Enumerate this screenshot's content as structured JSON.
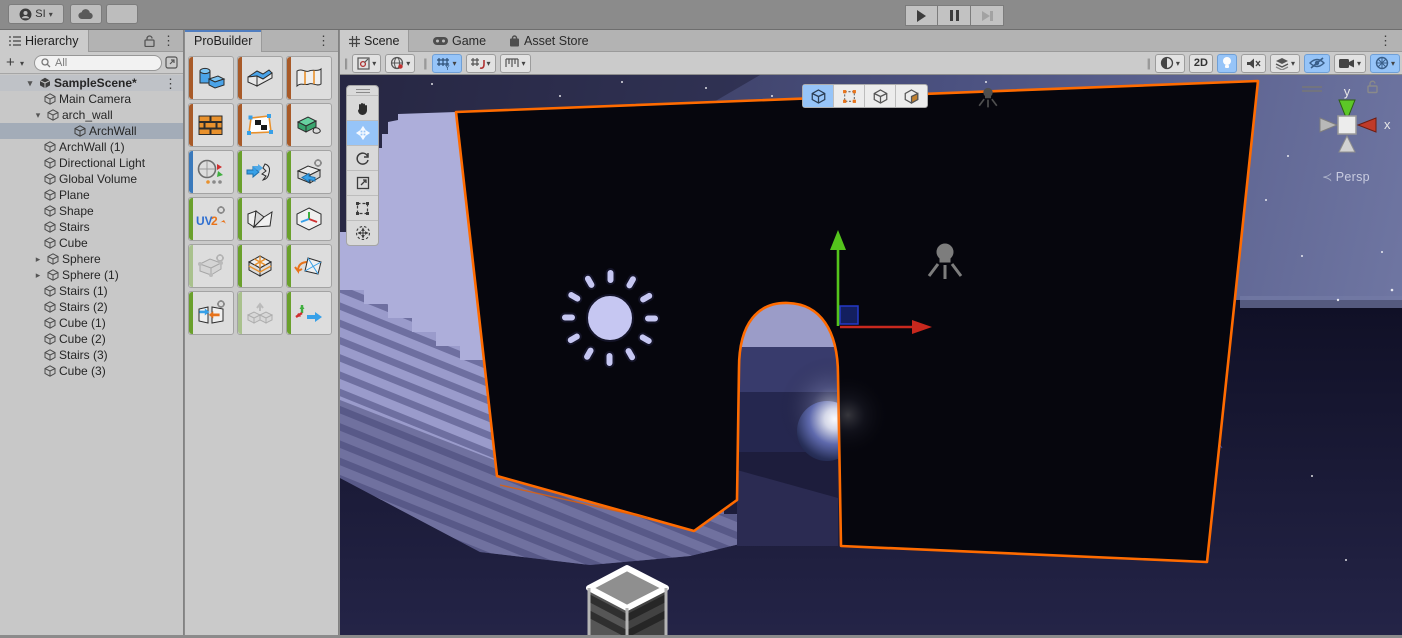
{
  "top_bar": {
    "account_label": "SI",
    "icons": [
      "person-icon",
      "cloud-icon",
      "play-icon",
      "pause-icon",
      "step-icon"
    ]
  },
  "glyphs": {
    "caret": "▾",
    "kebab": "⋮",
    "plus": "+",
    "arrow_expanded": "▾",
    "arrow_collapsed": "▸",
    "handle": "||"
  },
  "hierarchy": {
    "tab": "Hierarchy",
    "search_placeholder": "All",
    "scene_row": {
      "label": "SampleScene*"
    },
    "items": [
      {
        "label": "Main Camera",
        "depth": 1
      },
      {
        "label": "arch_wall",
        "depth": 1,
        "expanded": true
      },
      {
        "label": "ArchWall",
        "depth": 2,
        "selected": true
      },
      {
        "label": "ArchWall (1)",
        "depth": 1
      },
      {
        "label": "Directional Light",
        "depth": 1
      },
      {
        "label": "Global Volume",
        "depth": 1
      },
      {
        "label": "Plane",
        "depth": 1
      },
      {
        "label": "Shape",
        "depth": 1
      },
      {
        "label": "Stairs",
        "depth": 1
      },
      {
        "label": "Cube",
        "depth": 1
      },
      {
        "label": "Sphere",
        "depth": 1,
        "collapsed": true
      },
      {
        "label": "Sphere (1)",
        "depth": 1,
        "collapsed": true
      },
      {
        "label": "Stairs (1)",
        "depth": 1
      },
      {
        "label": "Stairs (2)",
        "depth": 1
      },
      {
        "label": "Cube (1)",
        "depth": 1
      },
      {
        "label": "Cube (2)",
        "depth": 1
      },
      {
        "label": "Stairs (3)",
        "depth": 1
      },
      {
        "label": "Cube (3)",
        "depth": 1
      }
    ]
  },
  "probuilder": {
    "tab": "ProBuilder",
    "uv2_label": "UV2",
    "tools": [
      {
        "name": "new-shape-tool"
      },
      {
        "name": "new-poly-shape-tool"
      },
      {
        "name": "new-bezier-shape-tool"
      },
      {
        "name": "material-editor-tool"
      },
      {
        "name": "uv-editor-tool"
      },
      {
        "name": "vertex-colors-tool"
      },
      {
        "name": "smoothing-groups-tool"
      },
      {
        "name": "probuilderize-tool"
      },
      {
        "name": "export-tool"
      },
      {
        "name": "lightmap-uvs-tool"
      },
      {
        "name": "flip-normals-tool"
      },
      {
        "name": "center-pivot-tool"
      },
      {
        "name": "conform-normals-tool",
        "disabled": true
      },
      {
        "name": "subdivide-object-tool"
      },
      {
        "name": "triangulate-tool"
      },
      {
        "name": "mirror-objects-tool"
      },
      {
        "name": "merge-objects-tool",
        "disabled": true
      },
      {
        "name": "freeze-transform-tool"
      }
    ]
  },
  "scene_view": {
    "tabs": {
      "scene": "Scene",
      "game": "Game",
      "asset_store": "Asset Store"
    },
    "toolbar": {
      "mode_2d": "2D"
    },
    "edit_modes": [
      "object-mode",
      "vertex-mode",
      "edge-mode",
      "face-mode"
    ],
    "tools": [
      "view-tool",
      "move-tool",
      "rotate-tool",
      "scale-tool",
      "rect-tool",
      "transform-tool"
    ],
    "axis": {
      "x": "x",
      "y": "y"
    },
    "persp": {
      "arrow": "≺",
      "label": "Persp"
    }
  },
  "colors": {
    "selection_outline": "#ff6b00",
    "active_toggle": "#96c4f8",
    "wireframe": "#3c4fa8",
    "sun_gizmo": "#c6c7f2"
  }
}
